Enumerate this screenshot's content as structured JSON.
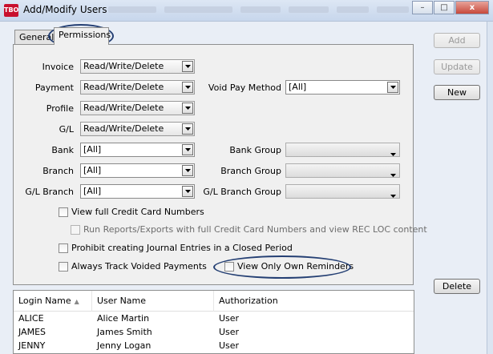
{
  "window": {
    "title": "Add/Modify Users",
    "app_icon_text": "TBO",
    "min_glyph": "–",
    "max_glyph": "□",
    "close_glyph": "x"
  },
  "tabs": [
    {
      "label": "General",
      "active": false
    },
    {
      "label": "Permissions",
      "active": true
    }
  ],
  "permissions": {
    "invoice": {
      "label": "Invoice",
      "value": "Read/Write/Delete"
    },
    "payment": {
      "label": "Payment",
      "value": "Read/Write/Delete"
    },
    "profile": {
      "label": "Profile",
      "value": "Read/Write/Delete"
    },
    "gl": {
      "label": "G/L",
      "value": "Read/Write/Delete"
    },
    "bank": {
      "label": "Bank",
      "value": "[All]"
    },
    "branch": {
      "label": "Branch",
      "value": "[All]"
    },
    "gl_branch": {
      "label": "G/L Branch",
      "value": "[All]"
    },
    "void_pay_method": {
      "label": "Void Pay Method",
      "value": "[All]"
    },
    "bank_group": {
      "label": "Bank Group",
      "value": ""
    },
    "branch_group": {
      "label": "Branch Group",
      "value": ""
    },
    "gl_branch_group": {
      "label": "G/L Branch Group",
      "value": ""
    }
  },
  "checkboxes": {
    "view_full_cc": {
      "label": "View full Credit Card Numbers",
      "checked": false
    },
    "run_reports_cc": {
      "label": "Run Reports/Exports with full Credit Card Numbers and view REC LOC content",
      "checked": false
    },
    "prohibit_je": {
      "label": "Prohibit creating Journal Entries in a Closed Period",
      "checked": false
    },
    "always_track_voided": {
      "label": "Always Track Voided Payments",
      "checked": false
    },
    "view_own_reminders": {
      "label": "View Only Own Reminders",
      "checked": false
    }
  },
  "buttons": {
    "add": "Add",
    "update": "Update",
    "new": "New",
    "delete": "Delete"
  },
  "users_table": {
    "columns": [
      "Login Name",
      "User Name",
      "Authorization"
    ],
    "rows": [
      [
        "ALICE",
        "Alice Martin",
        "User"
      ],
      [
        "JAMES",
        "James Smith",
        "User"
      ],
      [
        "JENNY",
        "Jenny Logan",
        "User"
      ]
    ]
  },
  "colors": {
    "highlight_oval": "#243f73",
    "app_icon": "#c8102e"
  }
}
